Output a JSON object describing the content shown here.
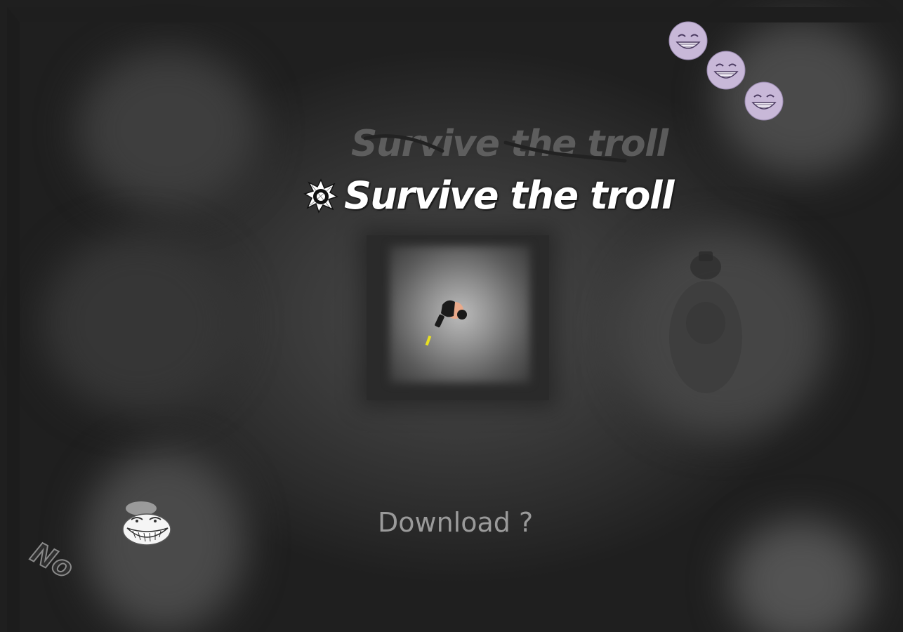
{
  "objective": {
    "previous_text": "Survive the troll",
    "current_text": "Survive the troll"
  },
  "prompt": {
    "download_label": "Download ?",
    "no_label": "No"
  },
  "lives": {
    "count": 3
  },
  "icons": {
    "objective_marker": "bullet-hole-icon",
    "lives": "smiley-face-icon",
    "player": "player-with-gun",
    "enemy": "troll-face",
    "shadow": "shadow-figure"
  },
  "colors": {
    "title_main": "#ffffff",
    "title_old": "#6e6e6e",
    "download": "#9a9a9a",
    "life_face": "#c8b8d8",
    "bullet": "#e8e020"
  }
}
